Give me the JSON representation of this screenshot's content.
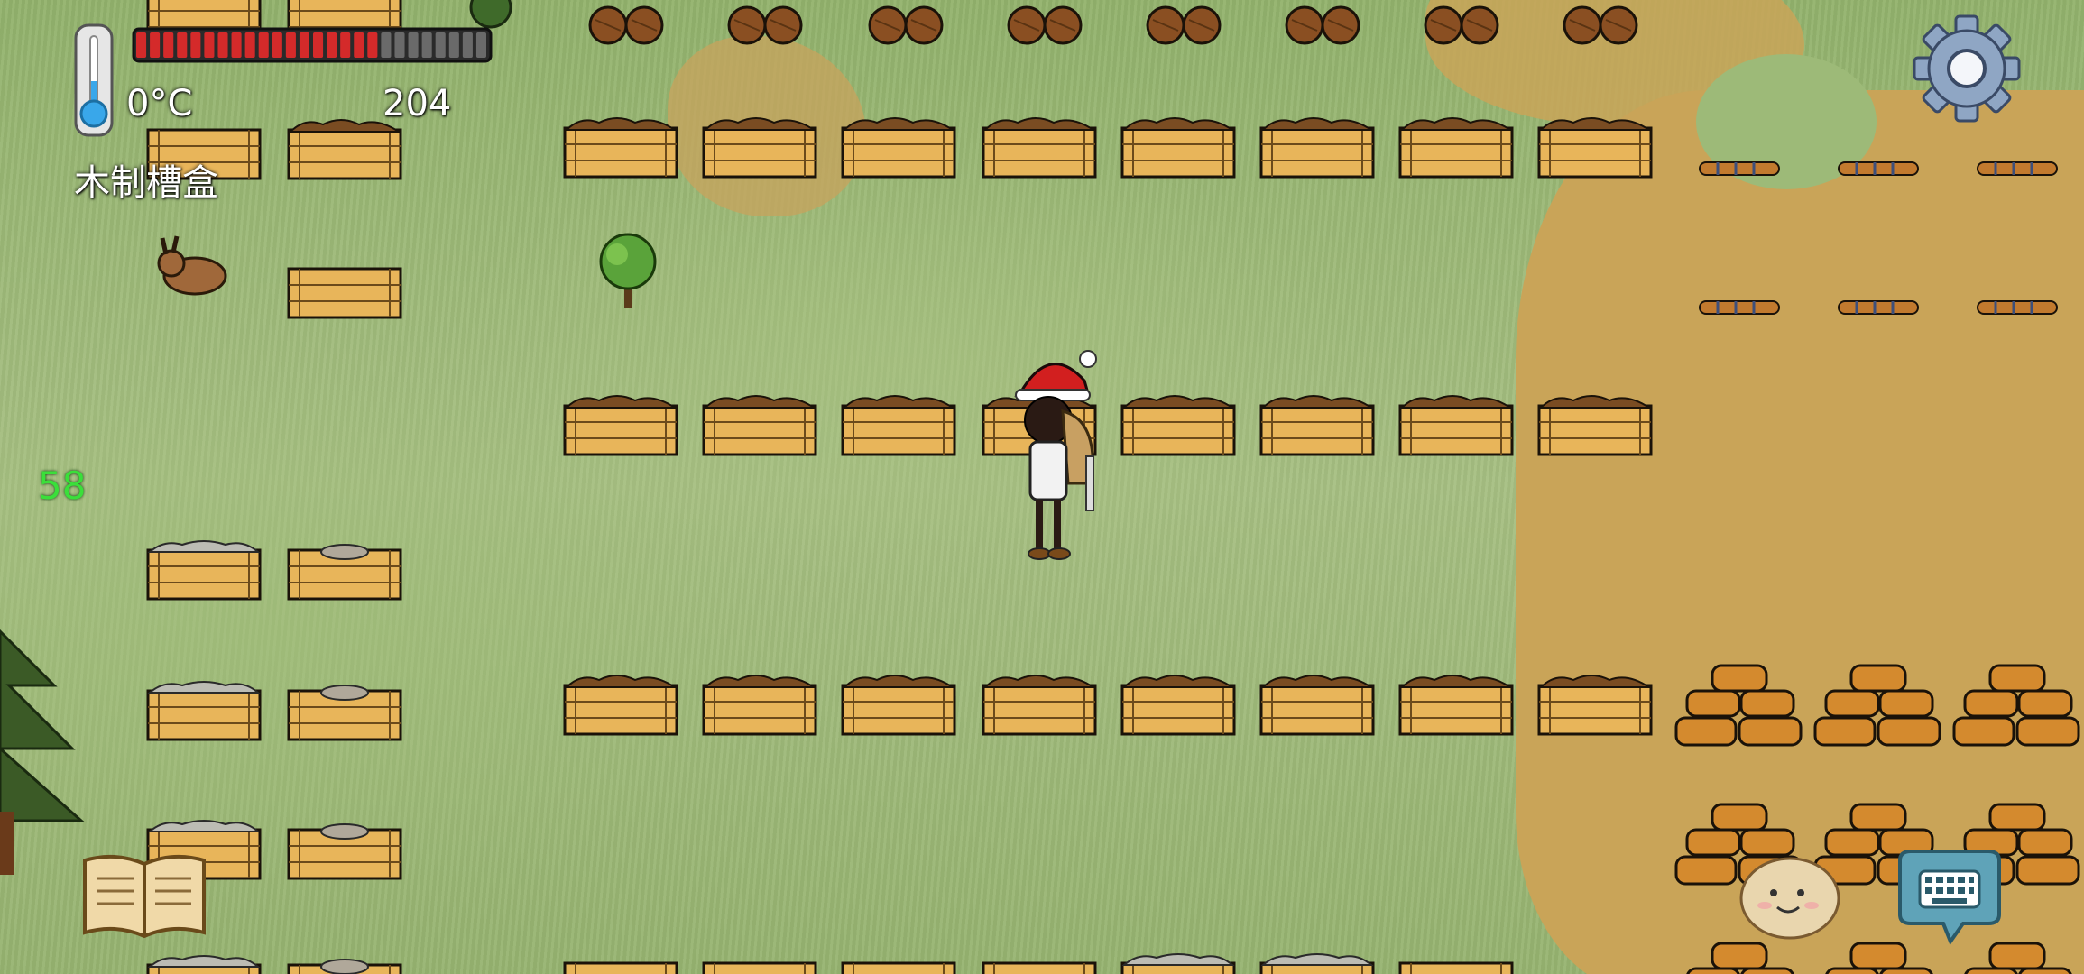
{
  "hud": {
    "temperature": "0°C",
    "food_count": "204",
    "held_item": "木制槽盒",
    "food_meter": {
      "filled_segments": 18,
      "total_segments": 26,
      "color": "#d42a2a"
    },
    "fps": "58"
  },
  "icons": {
    "thermometer": "thermometer-icon",
    "settings": "gear-icon",
    "book": "open-book-icon",
    "emote": "potato-face-icon",
    "keyboard": "keyboard-chat-icon"
  },
  "colors": {
    "grass": "#9bb877",
    "dirt": "#c9a458",
    "crate_wood": "#e8b55a",
    "fps_text": "#3adf3a"
  }
}
